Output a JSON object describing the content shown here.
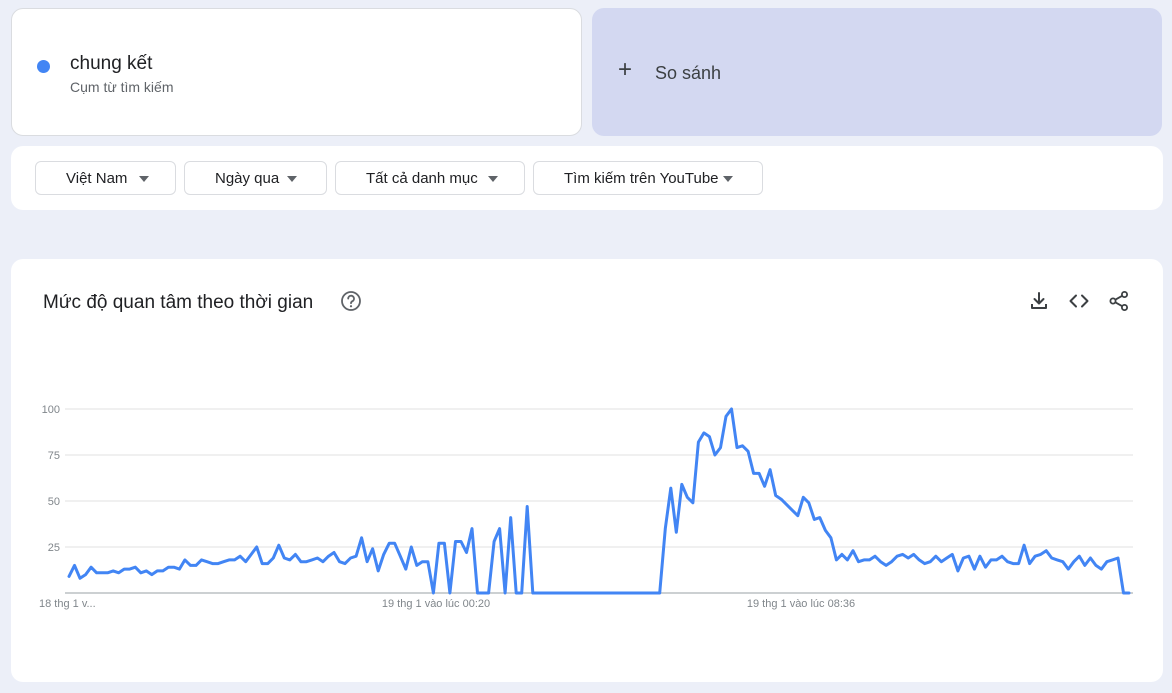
{
  "search_term": {
    "title": "chung kết",
    "subtitle": "Cụm từ tìm kiếm",
    "color": "#4285f4"
  },
  "compare": {
    "label": "So sánh"
  },
  "filters": {
    "region": "Việt Nam",
    "time": "Ngày qua",
    "category": "Tất cả danh mục",
    "source": "Tìm kiếm trên YouTube"
  },
  "chart_section": {
    "title": "Mức độ quan tâm theo thời gian"
  },
  "chart_data": {
    "type": "line",
    "x_tick_labels": [
      "18 thg 1 v...",
      "19 thg 1 vào lúc 00:20",
      "19 thg 1 vào lúc 08:36"
    ],
    "y_ticks": [
      25,
      50,
      75,
      100
    ],
    "ylim": [
      0,
      100
    ],
    "grid": true,
    "series": [
      {
        "color": "#4285f4",
        "values": [
          9,
          15,
          8,
          10,
          14,
          11,
          11,
          11,
          12,
          11,
          13,
          13,
          14,
          11,
          12,
          10,
          12,
          12,
          14,
          14,
          13,
          18,
          15,
          15,
          18,
          17,
          16,
          16,
          17,
          18,
          18,
          20,
          17,
          21,
          25,
          16,
          16,
          19,
          26,
          19,
          18,
          21,
          17,
          17,
          18,
          19,
          17,
          20,
          22,
          17,
          16,
          19,
          20,
          30,
          17,
          24,
          12,
          21,
          27,
          27,
          20,
          13,
          25,
          15,
          17,
          17,
          0,
          27,
          27,
          0,
          28,
          28,
          22,
          35,
          0,
          0,
          0,
          28,
          35,
          0,
          41,
          0,
          0,
          47,
          0,
          0,
          0,
          0,
          0,
          0,
          0,
          0,
          0,
          0,
          0,
          0,
          0,
          0,
          0,
          0,
          0,
          0,
          0,
          0,
          0,
          0,
          0,
          0,
          35,
          57,
          33,
          59,
          52,
          49,
          82,
          87,
          85,
          75,
          79,
          96,
          100,
          79,
          80,
          77,
          65,
          65,
          58,
          67,
          53,
          51,
          48,
          45,
          42,
          52,
          49,
          40,
          41,
          34,
          30,
          18,
          21,
          18,
          23,
          17,
          18,
          18,
          20,
          17,
          15,
          17,
          20,
          21,
          19,
          21,
          18,
          16,
          17,
          20,
          17,
          19,
          21,
          12,
          19,
          20,
          13,
          20,
          14,
          18,
          18,
          20,
          17,
          16,
          16,
          26,
          16,
          20,
          21,
          23,
          19,
          18,
          17,
          13,
          17,
          20,
          15,
          19,
          15,
          13,
          17,
          18,
          19,
          0,
          0
        ]
      }
    ]
  }
}
